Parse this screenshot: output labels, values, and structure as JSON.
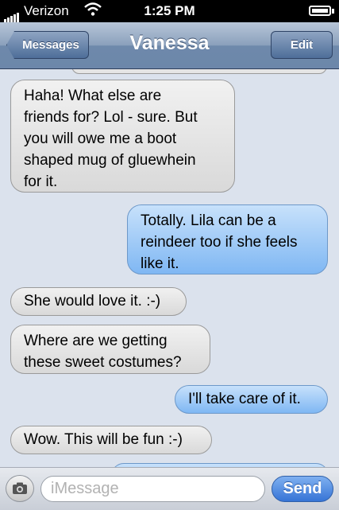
{
  "status_bar": {
    "carrier": "Verizon",
    "time": "1:25 PM",
    "signal_icon": "signal-bars-icon",
    "wifi_icon": "wifi-icon",
    "battery_icon": "battery-icon"
  },
  "nav": {
    "back_label": "Messages",
    "title": "Vanessa",
    "edit_label": "Edit"
  },
  "messages": [
    {
      "direction": "incoming",
      "text": "Haha!  What else are\nfriends for? Lol - sure. But\nyou will owe me a boot\nshaped mug of gluewhein\nfor it."
    },
    {
      "direction": "outgoing",
      "text": "Totally. Lila can be a\nreindeer too if she feels\nlike it."
    },
    {
      "direction": "incoming",
      "text": "She would love it. :-)"
    },
    {
      "direction": "incoming",
      "text": "Where are we getting\nthese sweet costumes?"
    },
    {
      "direction": "outgoing",
      "text": "I'll take care of it."
    },
    {
      "direction": "incoming",
      "text": "Wow. This will be fun :-)"
    }
  ],
  "input": {
    "placeholder": "iMessage",
    "send_label": "Send",
    "camera_icon": "camera-icon"
  },
  "colors": {
    "incoming_bubble": "#e0e0e0",
    "outgoing_bubble": "#9cc8f5",
    "background": "#dbe2ed",
    "send_button": "#3674d6"
  }
}
